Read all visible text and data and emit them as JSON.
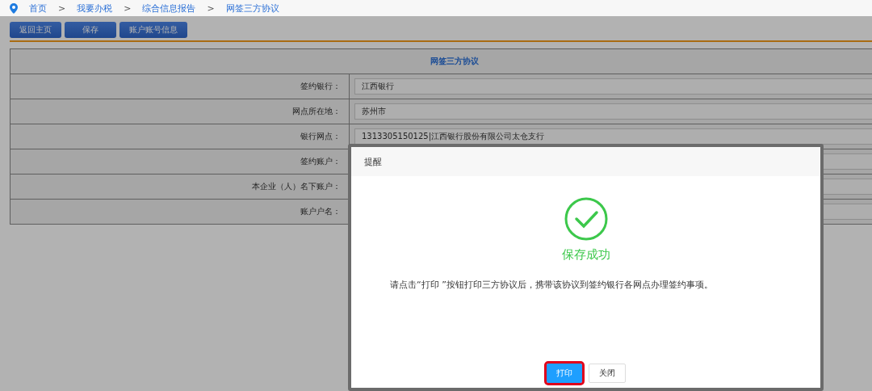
{
  "breadcrumb": [
    {
      "label": "首页"
    },
    {
      "label": "我要办税"
    },
    {
      "label": "综合信息报告"
    },
    {
      "label": "网签三方协议"
    }
  ],
  "breadcrumb_separator": ">",
  "toolbar": [
    {
      "label": "返回主页"
    },
    {
      "label": "保存"
    },
    {
      "label": "账户账号信息"
    }
  ],
  "form": {
    "title": "网签三方协议",
    "rows": [
      {
        "label": "签约银行：",
        "value": "江西银行"
      },
      {
        "label": "网点所在地：",
        "value": "苏州市"
      },
      {
        "label": "银行网点：",
        "value": "1313305150125|江西银行股份有限公司太仓支行"
      },
      {
        "label": "签约账户："
      },
      {
        "label": "本企业（人）名下账户："
      },
      {
        "label": "账户户名："
      }
    ]
  },
  "dialog": {
    "title": "提醒",
    "status": "保存成功",
    "message": "请点击“打印 ”按钮打印三方协议后，携带该协议到签约银行各网点办理签约事项。",
    "buttons": [
      {
        "label": "打印",
        "kind": "primary",
        "highlighted": true
      },
      {
        "label": "关闭",
        "kind": "default",
        "highlighted": false
      }
    ]
  }
}
